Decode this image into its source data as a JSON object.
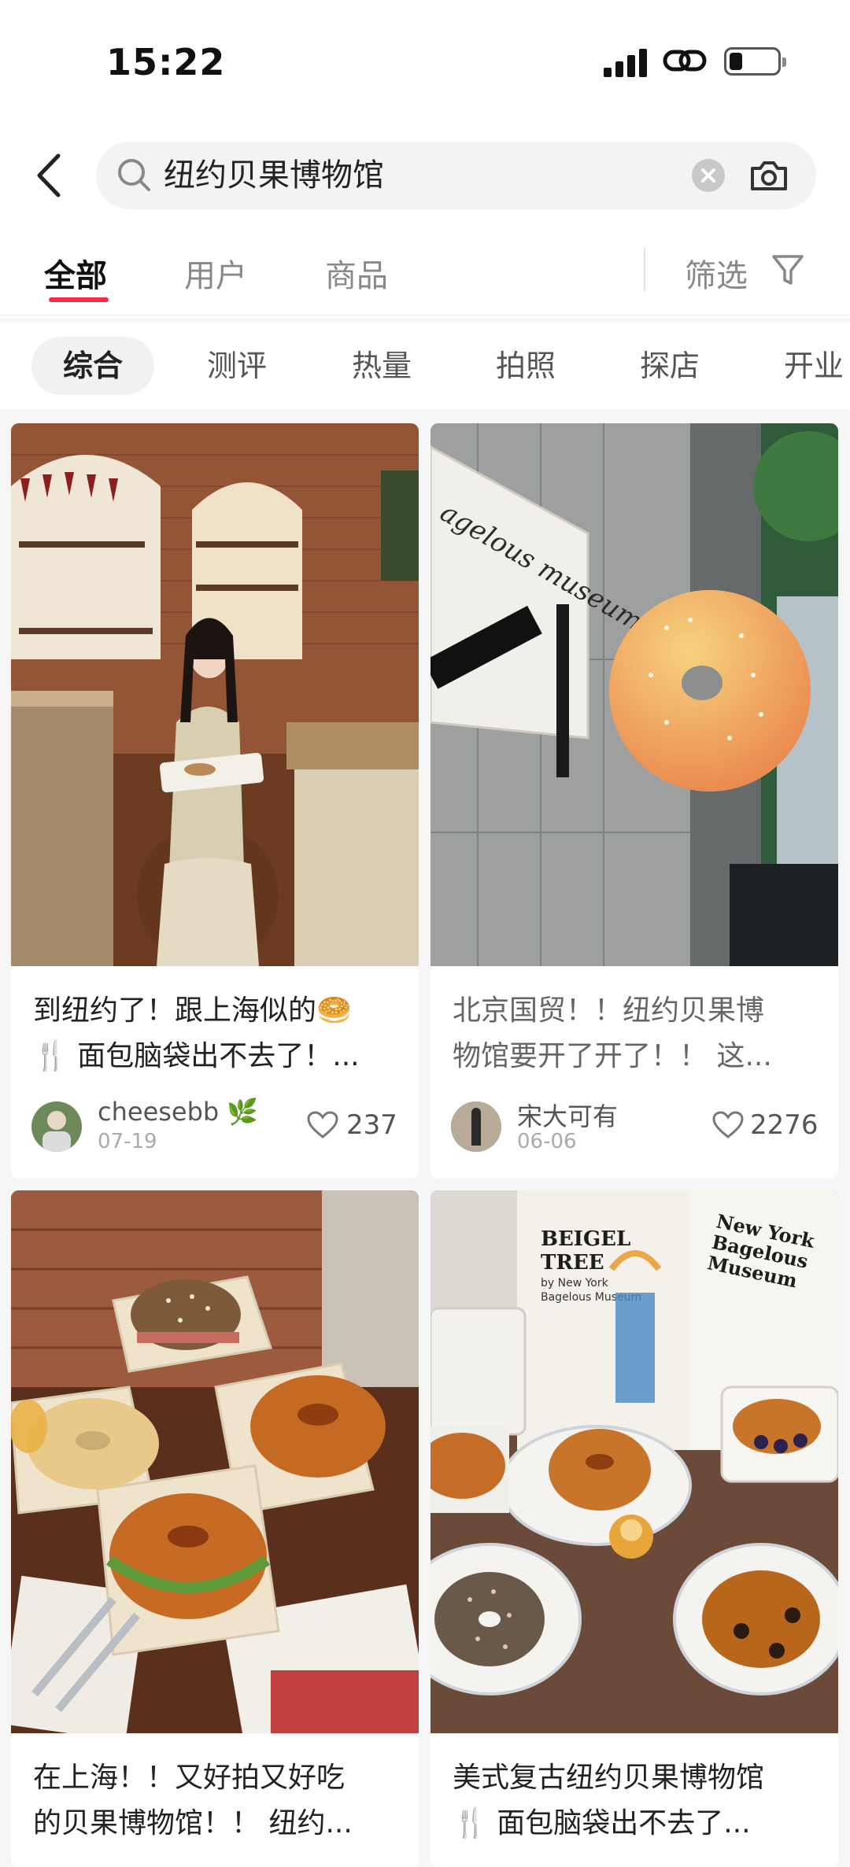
{
  "status_bar": {
    "time": "15:22"
  },
  "search": {
    "query": "纽约贝果博物馆"
  },
  "tabs": [
    {
      "label": "全部",
      "active": true
    },
    {
      "label": "用户",
      "active": false
    },
    {
      "label": "商品",
      "active": false
    }
  ],
  "filter": {
    "label": "筛选"
  },
  "chips": [
    {
      "label": "综合",
      "active": true
    },
    {
      "label": "测评"
    },
    {
      "label": "热量"
    },
    {
      "label": "拍照"
    },
    {
      "label": "探店"
    },
    {
      "label": "开业"
    }
  ],
  "posts": [
    {
      "title_line1": "到纽约了！跟上海似的🥯",
      "title_line2": "🍴 面包脑袋出不去了！...",
      "author": "cheesebb 🌿",
      "date": "07-19",
      "likes": "237"
    },
    {
      "title_line1": "北京国贸！！纽约贝果博",
      "title_line2": "物馆要开了开了！！ 这...",
      "author": "宋大可有",
      "date": "06-06",
      "likes": "2276",
      "photo_texts": [
        "agelous museum"
      ]
    },
    {
      "title_line1": "在上海！！又好拍又好吃",
      "title_line2": "的贝果博物馆！！ 纽约..."
    },
    {
      "title_line1": "美式复古纽约贝果博物馆",
      "title_line2": "🍴 面包脑袋出不去了...",
      "photo_texts": [
        "BEIGEL",
        "TREE",
        "by New York",
        "Bagelous Museum",
        "New York",
        "Bagelous",
        "Museum"
      ]
    }
  ],
  "colors": {
    "accent": "#ff2a4a"
  }
}
